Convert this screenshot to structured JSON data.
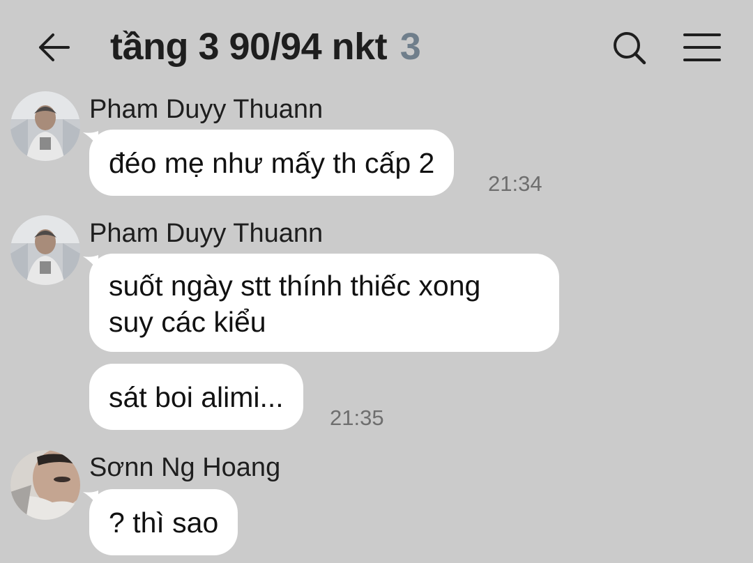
{
  "header": {
    "title": "tầng 3 90/94 nkt",
    "member_count": "3",
    "icons": {
      "back": "arrow-left-icon",
      "search": "search-icon",
      "menu": "menu-icon"
    }
  },
  "messages": [
    {
      "sender": "Pham Duyy Thuann",
      "text": "đéo mẹ như mấy th cấp 2",
      "time": "21:34"
    },
    {
      "sender": "Pham Duyy Thuann",
      "text_line1": "suốt ngày stt thính thiếc xong",
      "text_line2": "suy các kiểu"
    },
    {
      "text": "sát boi alimi...",
      "time": "21:35"
    },
    {
      "sender": "Sơnn Ng Hoang",
      "text": "? thì sao"
    }
  ],
  "colors": {
    "background": "#cbcbcb",
    "bubble": "#ffffff",
    "count_accent": "#6f7e8b"
  }
}
